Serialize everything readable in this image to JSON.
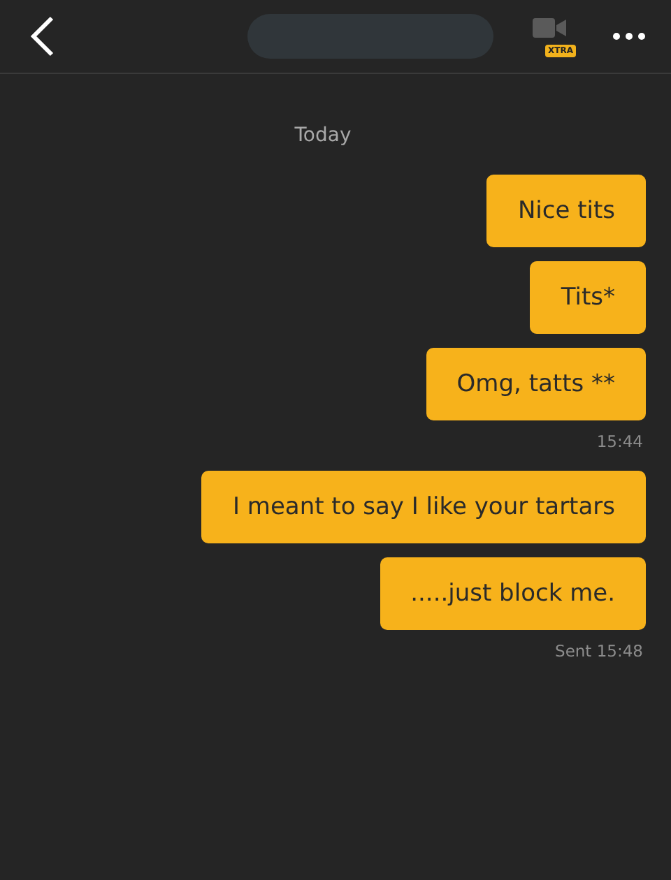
{
  "header": {
    "video_badge": "XTRA"
  },
  "date_divider": "Today",
  "messages": [
    {
      "kind": "bubble",
      "text": "Nice tits"
    },
    {
      "kind": "bubble",
      "text": "Tits*"
    },
    {
      "kind": "bubble",
      "text": "Omg, tatts **"
    },
    {
      "kind": "time",
      "text": "15:44"
    },
    {
      "kind": "bubble",
      "text": "I meant to say I like your tartars"
    },
    {
      "kind": "bubble",
      "text": ".....just block me."
    },
    {
      "kind": "time",
      "text": "Sent 15:48"
    }
  ]
}
